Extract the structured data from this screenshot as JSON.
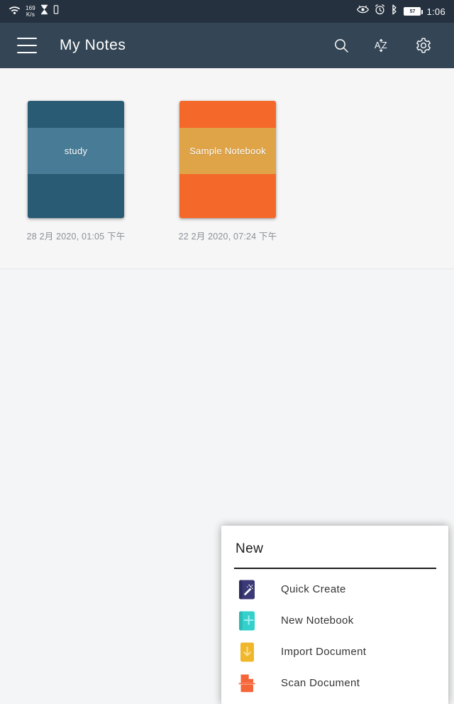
{
  "statusbar": {
    "network_speed_value": "169",
    "network_speed_unit": "K/s",
    "wifi_icon": "wifi-icon",
    "hourglass_icon": "hourglass-icon",
    "sim_icon": "sim-card-icon",
    "eye_icon": "eye-icon",
    "alarm_icon": "alarm-clock-icon",
    "bluetooth_icon": "bluetooth-icon",
    "battery_level": "57",
    "time": "1:06"
  },
  "appbar": {
    "menu_icon": "hamburger-menu-icon",
    "title": "My Notes",
    "search_icon": "search-icon",
    "sort_label": "AZ",
    "sort_icon": "sort-az-icon",
    "settings_icon": "gear-icon",
    "background": "#344655"
  },
  "notebooks": [
    {
      "title": "study",
      "date": "28 2月 2020, 01:05 下午",
      "cover_color": "#2a5b75",
      "band_color": "#477b96"
    },
    {
      "title": "Sample Notebook",
      "date": "22 2月 2020, 07:24 下午",
      "cover_color": "#f4692a",
      "band_color": "#dfa447"
    }
  ],
  "dialog": {
    "title": "New",
    "items": [
      {
        "label": "Quick Create",
        "icon": "magic-wand-notebook-icon",
        "color": "#3b3a77"
      },
      {
        "label": "New Notebook",
        "icon": "plus-notebook-icon",
        "color": "#34d0cc"
      },
      {
        "label": "Import Document",
        "icon": "download-document-icon",
        "color": "#f0b72c"
      },
      {
        "label": "Scan Document",
        "icon": "scan-document-icon",
        "color": "#f4663a"
      }
    ]
  }
}
